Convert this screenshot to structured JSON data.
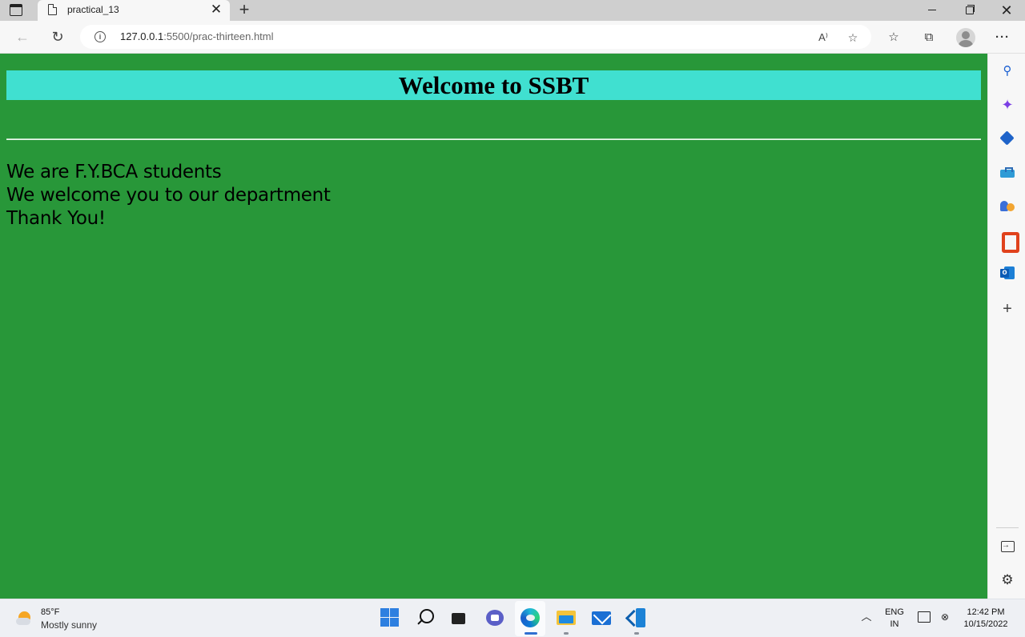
{
  "browser": {
    "tab_title": "practical_13",
    "tab_close": "✕",
    "new_tab": "+",
    "url_host": "127.0.0.1",
    "url_rest": ":5500/prac-thirteen.html",
    "read_aloud": "A⁾",
    "window_close": "✕"
  },
  "page": {
    "heading": "Welcome to SSBT",
    "lines": [
      "We are F.Y.BCA students",
      "We welcome you to our department",
      "Thank You!"
    ],
    "background_color": "#289739",
    "banner_color": "#40e0d0"
  },
  "taskbar": {
    "weather_temp": "85°F",
    "weather_desc": "Mostly sunny",
    "lang_top": "ENG",
    "lang_bottom": "IN",
    "time": "12:42 PM",
    "date": "10/15/2022"
  }
}
